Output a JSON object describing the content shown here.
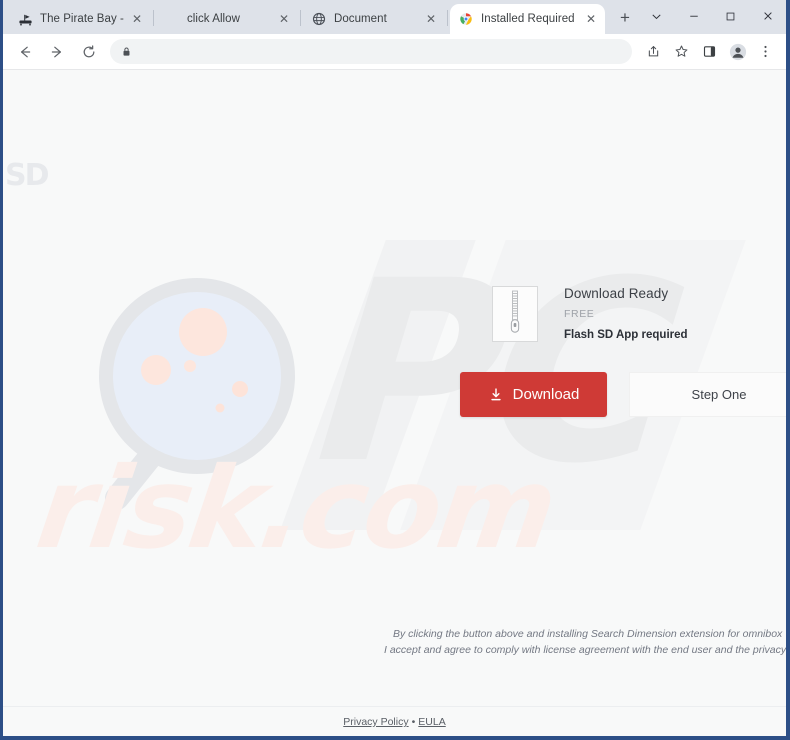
{
  "browser": {
    "tabs": [
      {
        "label": "The Pirate Bay - The gal",
        "favicon": "pirate-ship-icon",
        "active": false,
        "close_label": "✕"
      },
      {
        "label": "click Allow",
        "favicon": "red-circle-icon",
        "active": false,
        "close_label": "✕"
      },
      {
        "label": "Document",
        "favicon": "globe-icon",
        "active": false,
        "close_label": "✕"
      },
      {
        "label": "Installed Required",
        "favicon": "chrome-icon",
        "active": true,
        "close_label": "✕"
      }
    ],
    "new_tab_label": "+",
    "window_controls": {
      "tab_search": "⌄",
      "minimize": "–",
      "maximize": "□",
      "close": "✕"
    },
    "toolbar": {
      "back": "←",
      "forward": "→",
      "reload": "⟳",
      "omnibox_value": "",
      "omnibox_placeholder": "",
      "share_icon": "share-icon",
      "bookmark_icon": "star-icon",
      "sidepanel_icon": "side-panel-icon",
      "profile_icon": "profile-avatar-icon",
      "menu_icon": "three-dot-menu-icon"
    }
  },
  "page": {
    "logo_text": "SD",
    "watermarks": {
      "pc": "PC",
      "risk": "risk.com"
    },
    "product": {
      "title": "Download Ready",
      "price": "FREE",
      "requirement": "Flash SD App required",
      "file_icon": "zip-file-icon"
    },
    "actions": {
      "download_label": "Download",
      "download_icon": "download-arrow-icon",
      "step_label": "Step One"
    },
    "disclaimer": {
      "line1": "By clicking the button above and installing Search Dimension extension for omnibox",
      "line2": "I accept and agree to comply with license agreement with the end user and the privacy p"
    },
    "footer": {
      "privacy_label": "Privacy Policy",
      "separator": "•",
      "eula_label": "EULA"
    },
    "colors": {
      "accent_red": "#cf3a36",
      "window_border": "#2d4f87",
      "page_bg": "#f8f9f9"
    }
  }
}
